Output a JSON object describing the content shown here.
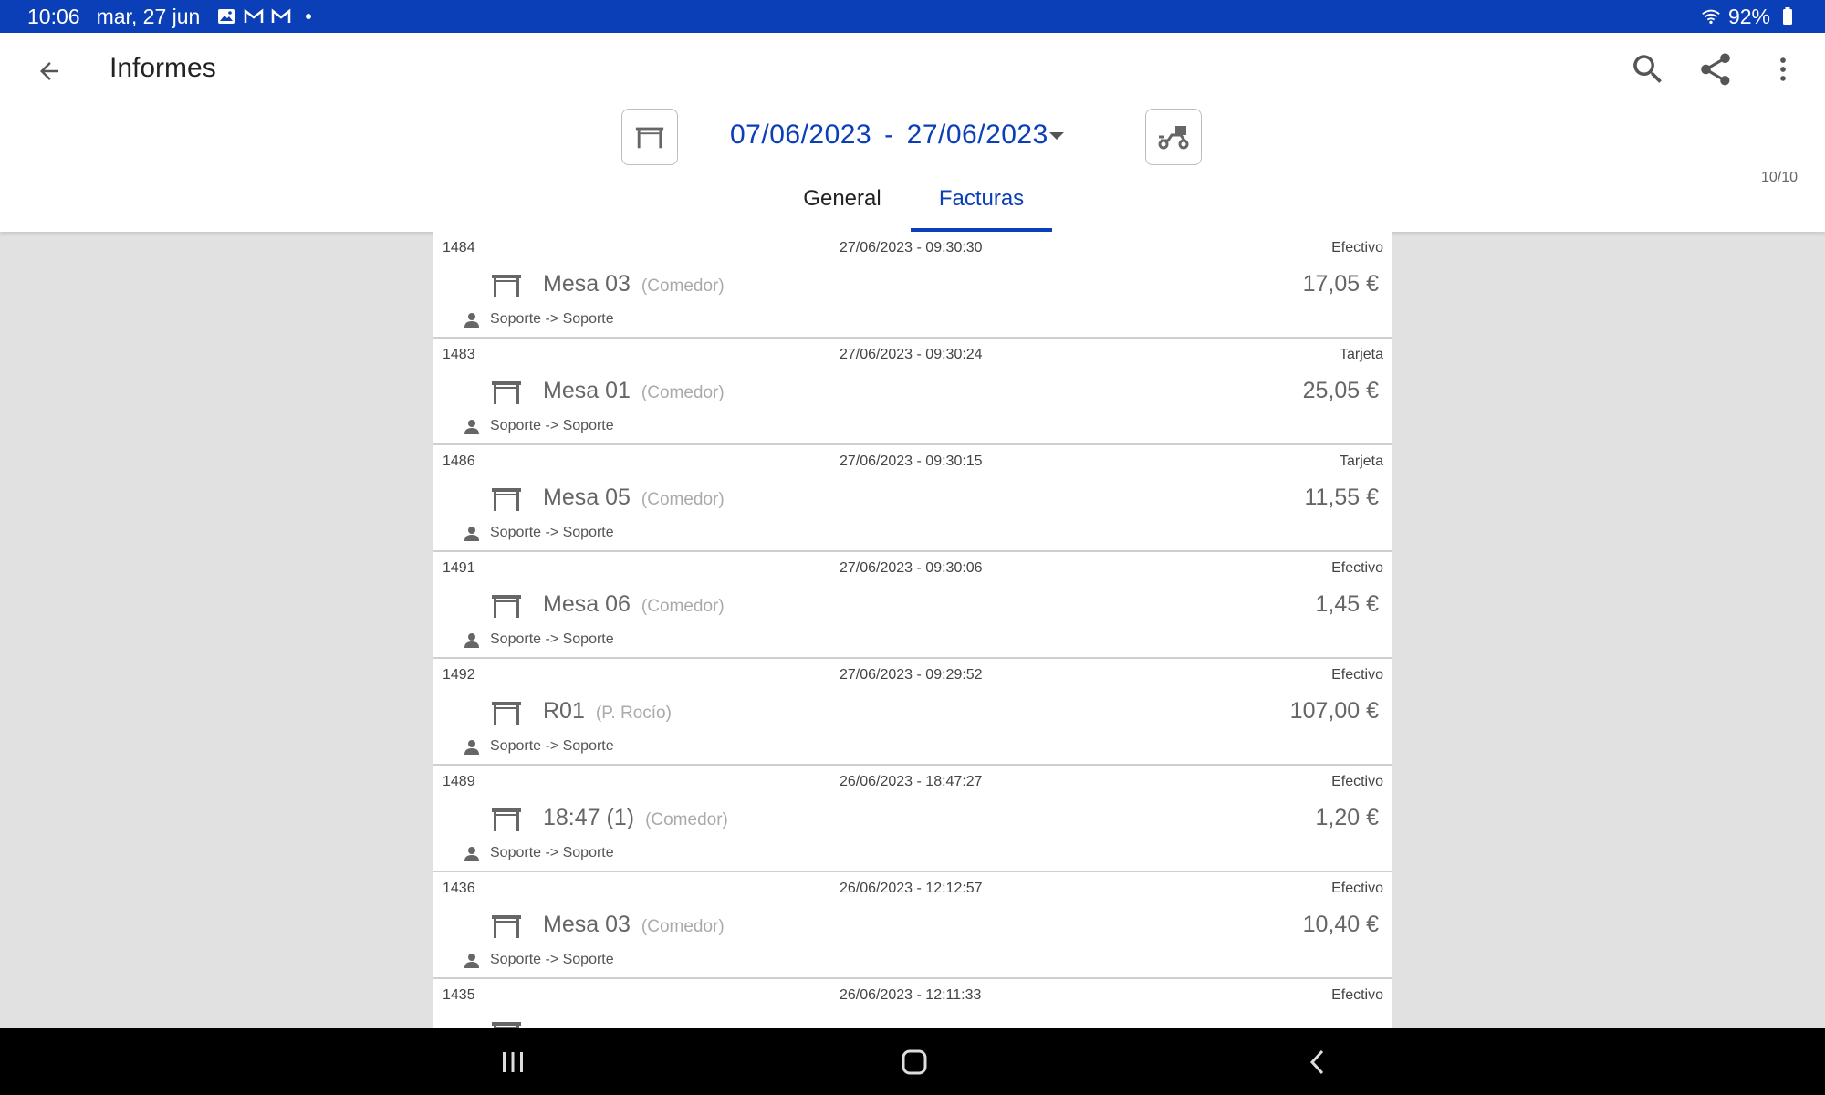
{
  "status_bar": {
    "time": "10:06",
    "date": "mar, 27 jun",
    "notifications": [
      "image-icon",
      "gmail-icon",
      "gmail-icon",
      "dot"
    ],
    "battery": "92%"
  },
  "header": {
    "title": "Informes",
    "date_from": "07/06/2023",
    "date_separator": "-",
    "date_to": "27/06/2023",
    "counter": "10/10"
  },
  "tabs": [
    {
      "label": "General",
      "active": false
    },
    {
      "label": "Facturas",
      "active": true
    }
  ],
  "invoices": [
    {
      "number": "1484",
      "datetime": "27/06/2023 - 09:30:30",
      "payment": "Efectivo",
      "table": "Mesa 03",
      "zone": "(Comedor)",
      "amount": "17,05 €",
      "user": "Soporte -> Soporte"
    },
    {
      "number": "1483",
      "datetime": "27/06/2023 - 09:30:24",
      "payment": "Tarjeta",
      "table": "Mesa 01",
      "zone": "(Comedor)",
      "amount": "25,05 €",
      "user": "Soporte -> Soporte"
    },
    {
      "number": "1486",
      "datetime": "27/06/2023 - 09:30:15",
      "payment": "Tarjeta",
      "table": "Mesa 05",
      "zone": "(Comedor)",
      "amount": "11,55 €",
      "user": "Soporte -> Soporte"
    },
    {
      "number": "1491",
      "datetime": "27/06/2023 - 09:30:06",
      "payment": "Efectivo",
      "table": "Mesa 06",
      "zone": "(Comedor)",
      "amount": "1,45 €",
      "user": "Soporte -> Soporte"
    },
    {
      "number": "1492",
      "datetime": "27/06/2023 - 09:29:52",
      "payment": "Efectivo",
      "table": "R01",
      "zone": "(P. Rocío)",
      "amount": "107,00 €",
      "user": "Soporte -> Soporte"
    },
    {
      "number": "1489",
      "datetime": "26/06/2023 - 18:47:27",
      "payment": "Efectivo",
      "table": "18:47 (1)",
      "zone": "(Comedor)",
      "amount": "1,20 €",
      "user": "Soporte -> Soporte"
    },
    {
      "number": "1436",
      "datetime": "26/06/2023 - 12:12:57",
      "payment": "Efectivo",
      "table": "Mesa 03",
      "zone": "(Comedor)",
      "amount": "10,40 €",
      "user": "Soporte -> Soporte"
    },
    {
      "number": "1435",
      "datetime": "26/06/2023 - 12:11:33",
      "payment": "Efectivo",
      "table": "",
      "zone": "",
      "amount": "",
      "user": ""
    }
  ],
  "colors": {
    "accent": "#0b3fb8",
    "background": "#e1e1e1"
  }
}
